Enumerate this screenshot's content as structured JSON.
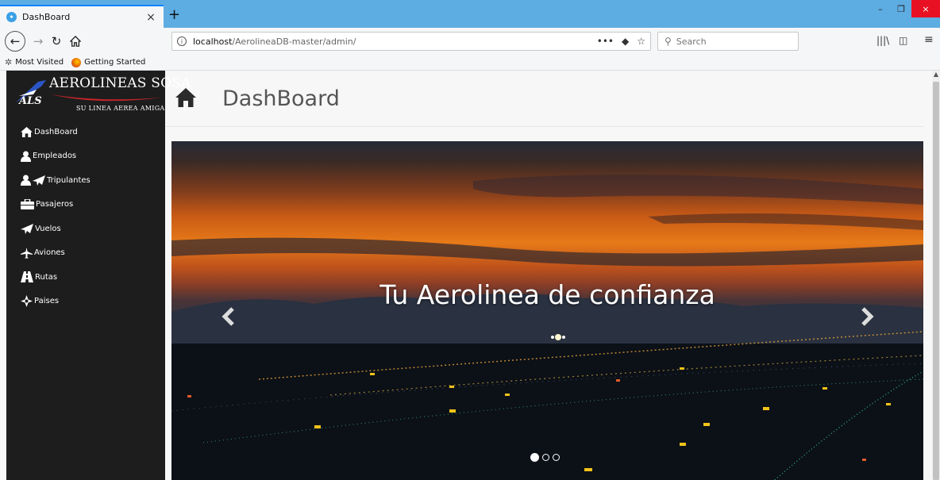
{
  "browser": {
    "tab_title": "DashBoard",
    "tab_close": "×",
    "new_tab": "+",
    "url_host": "localhost",
    "url_path": "/AerolineaDB-master/admin/",
    "search_placeholder": "Search",
    "bookmarks": [
      {
        "label": "Most Visited"
      },
      {
        "label": "Getting Started"
      }
    ],
    "window_controls": {
      "minimize": "–",
      "maximize": "❐",
      "close": "×"
    }
  },
  "sidebar": {
    "logo_name": "AEROLINEAS SOSA",
    "logo_tagline": "SU LINEA AEREA AMIGA",
    "menu": [
      {
        "label": "DashBoard",
        "icon": "home-icon"
      },
      {
        "label": "Empleados",
        "icon": "user-icon"
      },
      {
        "label": "Tripulantes",
        "icon": "user-plane-icon"
      },
      {
        "label": "Pasajeros",
        "icon": "briefcase-icon"
      },
      {
        "label": "Vuelos",
        "icon": "paper-plane-icon"
      },
      {
        "label": "Aviones",
        "icon": "plane-icon"
      },
      {
        "label": "Rutas",
        "icon": "road-icon"
      },
      {
        "label": "Paises",
        "icon": "compass-icon"
      }
    ]
  },
  "main": {
    "page_title": "DashBoard",
    "carousel": {
      "caption": "Tu Aerolinea de confianza",
      "slides": 3,
      "active_slide": 1
    }
  },
  "colors": {
    "tabbar": "#5dace2",
    "sidebar": "#1d1d1d",
    "close_button": "#e81123"
  }
}
